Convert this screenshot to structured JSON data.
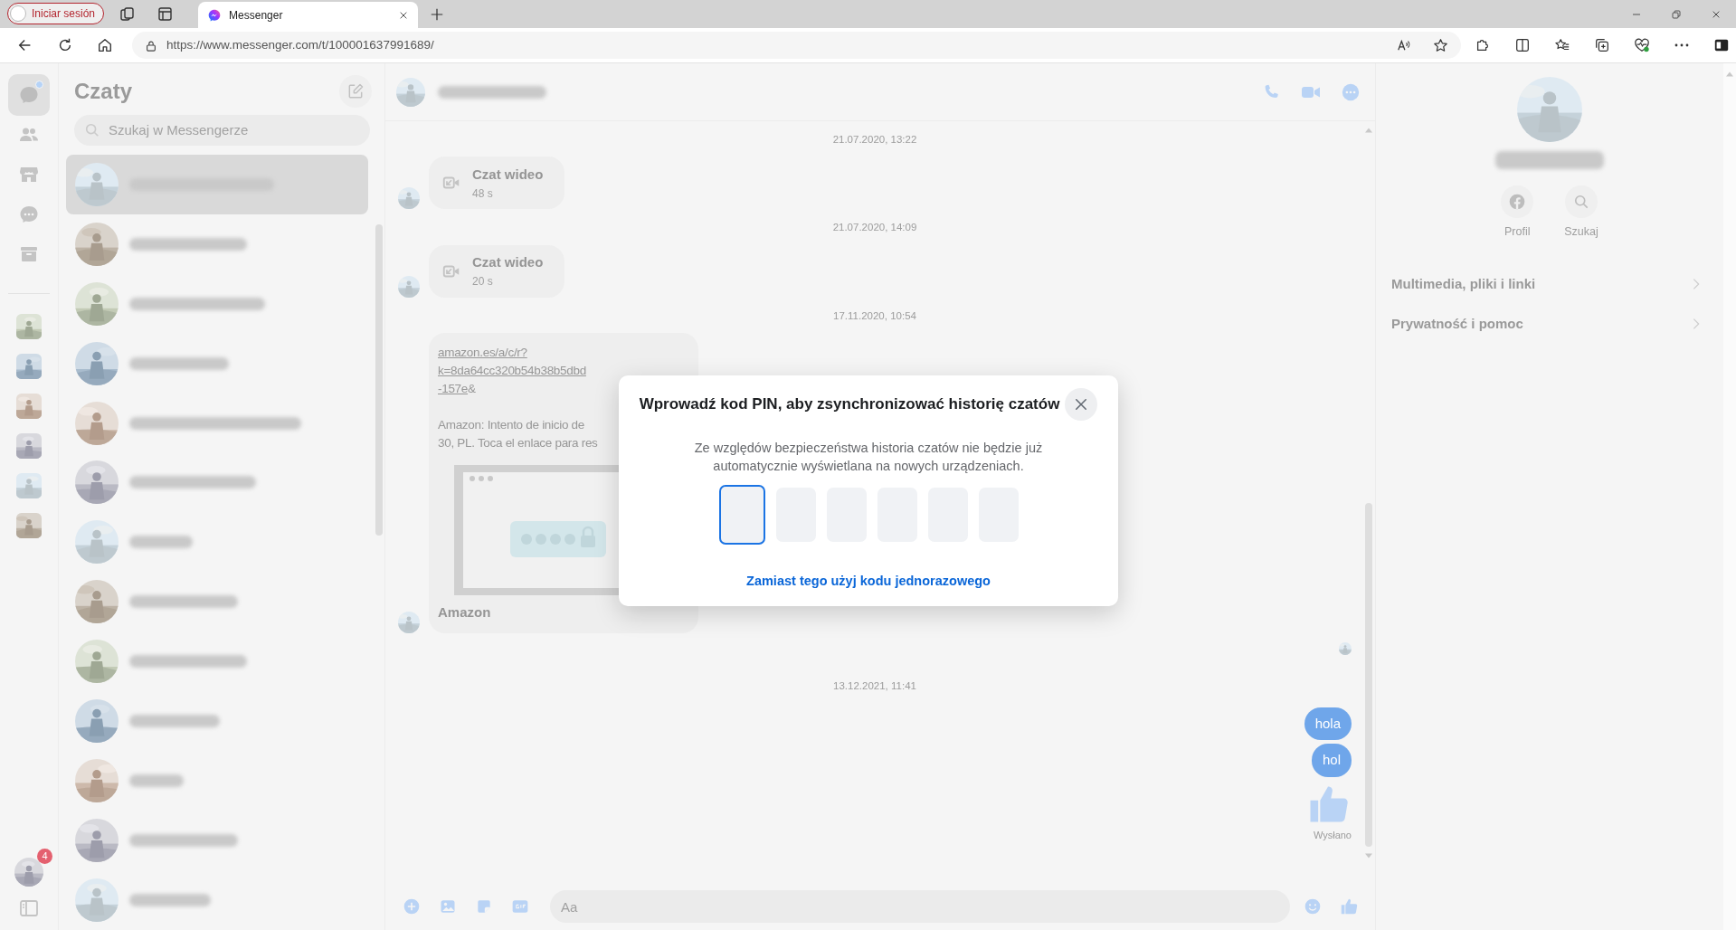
{
  "browser": {
    "profile_button": "Iniciar sesión",
    "tab_title": "Messenger",
    "url": "https://www.messenger.com/t/100001637991689/"
  },
  "rail": {
    "nav": [
      {
        "kind": "chats",
        "selected": true,
        "unread": true
      },
      {
        "kind": "people",
        "selected": false,
        "unread": false
      },
      {
        "kind": "store",
        "selected": false,
        "unread": false
      },
      {
        "kind": "requests",
        "selected": false,
        "unread": false
      },
      {
        "kind": "archive",
        "selected": false,
        "unread": false
      }
    ],
    "apps": [
      {
        "kind": "picture"
      },
      {
        "kind": "picture"
      },
      {
        "kind": "picture"
      },
      {
        "kind": "picture"
      },
      {
        "kind": "picture"
      },
      {
        "kind": "picture"
      }
    ],
    "account": {
      "kind": "picture",
      "badge": "4"
    }
  },
  "chat_list": {
    "title": "Czaty",
    "search": {
      "placeholder": "Szukaj w Messengerze"
    },
    "conversations": [
      {
        "kind": "picture",
        "selected": true
      },
      {
        "kind": "picture",
        "selected": false
      },
      {
        "kind": "picture",
        "selected": false
      },
      {
        "kind": "picture",
        "selected": false
      },
      {
        "kind": "picture",
        "selected": false
      },
      {
        "kind": "picture",
        "selected": false
      },
      {
        "kind": "picture",
        "selected": false
      },
      {
        "kind": "picture",
        "selected": false
      },
      {
        "kind": "picture",
        "selected": false
      },
      {
        "kind": "picture",
        "selected": false
      },
      {
        "kind": "picture",
        "selected": false
      },
      {
        "kind": "picture",
        "selected": false
      },
      {
        "kind": "picture",
        "selected": false
      }
    ]
  },
  "conversation": {
    "header": {
      "avatar": {
        "kind": "picture"
      }
    },
    "messages": [
      {
        "kind": "date",
        "text": "21.07.2020, 13:22"
      },
      {
        "kind": "call",
        "title": "Czat wideo",
        "duration": "48 s"
      },
      {
        "kind": "date",
        "text": "21.07.2020, 14:09"
      },
      {
        "kind": "call",
        "title": "Czat wideo",
        "duration": "20 s"
      },
      {
        "kind": "date",
        "text": "17.11.2020, 10:54"
      },
      {
        "kind": "link",
        "link_lines": [
          "amazon.es/a/c/r?",
          "k=8da64cc320b54b38b5dbd",
          "-157e"
        ],
        "link_tail": "&",
        "body_lines": [
          "Amazon: Intento de inicio de",
          "30, PL. Toca el enlace para res"
        ],
        "preview_caption": "Amazon"
      },
      {
        "kind": "seen"
      },
      {
        "kind": "date",
        "text": "13.12.2021, 11:41"
      },
      {
        "kind": "sent",
        "text": "hola"
      },
      {
        "kind": "sent",
        "text": "hol"
      },
      {
        "kind": "like"
      },
      {
        "kind": "status",
        "text": "Wysłano"
      }
    ],
    "composer": {
      "placeholder": "Aa"
    }
  },
  "details": {
    "avatar": {
      "kind": "picture"
    },
    "actions": [
      {
        "kind": "facebook",
        "label": "Profil"
      },
      {
        "kind": "search",
        "label": "Szukaj"
      }
    ],
    "rows": [
      "Multimedia, pliki i linki",
      "Prywatność i pomoc"
    ]
  },
  "pin_dialog": {
    "title": "Wprowadź kod PIN, aby zsynchronizować historię czatów",
    "text": "Ze względów bezpieczeństwa historia czatów nie będzie już automatycznie wyświetlana na nowych urządzeniach.",
    "digits": [
      {
        "selected": true
      },
      {
        "selected": false
      },
      {
        "selected": false
      },
      {
        "selected": false
      },
      {
        "selected": false
      },
      {
        "selected": false
      }
    ],
    "link": "Zamiast tego użyj kodu jednorazowego"
  }
}
